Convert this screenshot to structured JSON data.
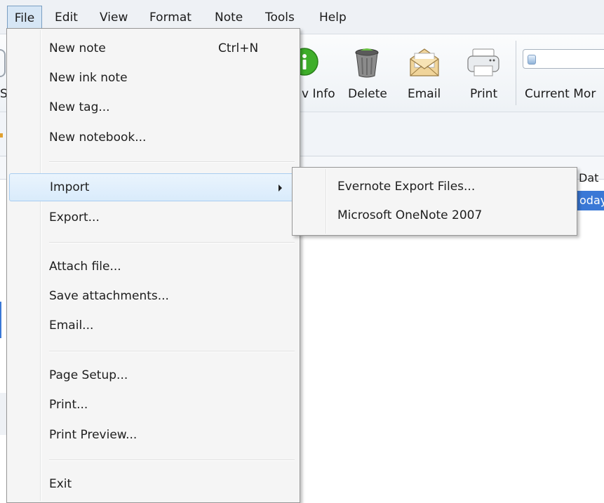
{
  "menubar": {
    "items": [
      "File",
      "Edit",
      "View",
      "Format",
      "Note",
      "Tools",
      "Help"
    ],
    "active": "File"
  },
  "toolbar": {
    "buttons": [
      {
        "label": "v Info",
        "icon": "info-icon"
      },
      {
        "label": "Delete",
        "icon": "trash-icon"
      },
      {
        "label": "Email",
        "icon": "envelope-icon"
      },
      {
        "label": "Print",
        "icon": "printer-icon"
      }
    ],
    "search_label": "Current Mor"
  },
  "left_fragments": {
    "toolbar_letter": "S"
  },
  "note_list": {
    "date_header": "Dat",
    "selected_row_text": "oday"
  },
  "file_menu": {
    "items": [
      {
        "label": "New note",
        "shortcut": "Ctrl+N"
      },
      {
        "label": "New ink note"
      },
      {
        "label": "New tag..."
      },
      {
        "label": "New notebook..."
      },
      {
        "label": "Import",
        "has_submenu": true,
        "highlighted": true
      },
      {
        "label": "Export..."
      },
      {
        "label": "Attach file..."
      },
      {
        "label": "Save attachments..."
      },
      {
        "label": "Email..."
      },
      {
        "label": "Page Setup..."
      },
      {
        "label": "Print..."
      },
      {
        "label": "Print Preview..."
      },
      {
        "label": "Exit"
      }
    ]
  },
  "import_submenu": {
    "items": [
      {
        "label": "Evernote Export Files..."
      },
      {
        "label": "Microsoft OneNote 2007"
      }
    ]
  },
  "colors": {
    "highlight": "#d9ebfb",
    "selection": "#3a78d6",
    "info_green": "#3fae2a"
  }
}
